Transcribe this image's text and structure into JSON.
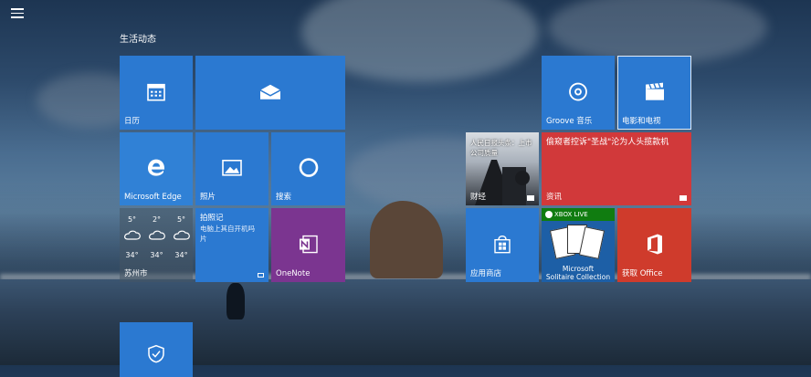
{
  "start_menu": {
    "group_title": "生活动态"
  },
  "tiles": {
    "calendar": {
      "label": "日历"
    },
    "mail": {
      "label": ""
    },
    "edge": {
      "label": "Microsoft Edge"
    },
    "photos": {
      "label": "照片"
    },
    "search": {
      "label": "搜索"
    },
    "weather": {
      "city": "苏州市",
      "forecast": [
        {
          "temp": "5°",
          "low": "34°"
        },
        {
          "temp": "2°",
          "low": "34°"
        },
        {
          "temp": "5°",
          "low": "34°"
        }
      ]
    },
    "camera_news": {
      "title": "拍照记",
      "subtitle": "电脑上其自开机吗",
      "subtitle2": "片"
    },
    "onenote": {
      "label": "OneNote"
    },
    "groove": {
      "label": "Groove 音乐"
    },
    "movies": {
      "label": "电影和电视"
    },
    "finance": {
      "headline": "人民日报头条：上市公司质量",
      "label": "财经"
    },
    "news": {
      "headline": "偷窥者控诉\"圣战\"沦为人头揽款机",
      "label": "资讯"
    },
    "store": {
      "label": "应用商店"
    },
    "solitaire": {
      "badge": "XBOX LIVE",
      "label1": "Microsoft",
      "label2": "Solitaire Collection"
    },
    "office": {
      "label": "获取 Office"
    }
  },
  "colors": {
    "tile_blue": "#2b79d1",
    "tile_purple": "#7b3590",
    "tile_red": "#d1393a",
    "xbox_green": "#107c10"
  }
}
